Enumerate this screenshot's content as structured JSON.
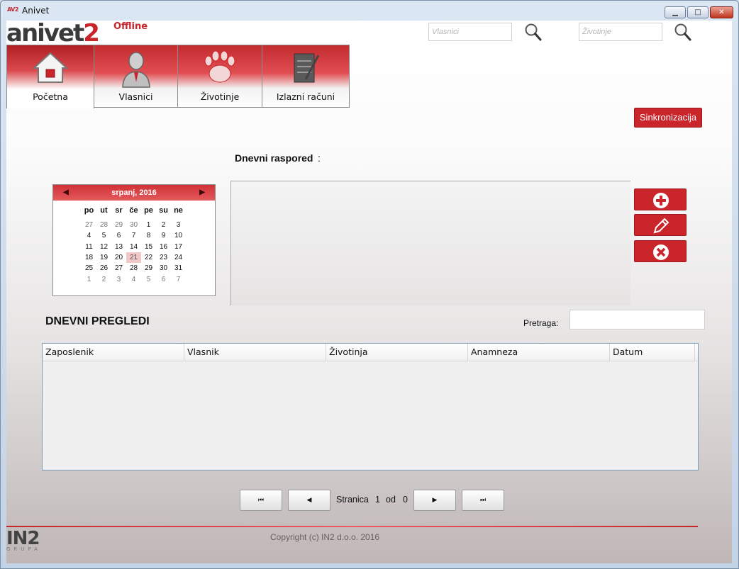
{
  "window": {
    "title": "Anivet",
    "app_icon_text": "AV2",
    "minimize_glyph": "▁",
    "maximize_glyph": "□",
    "close_glyph": "✕"
  },
  "logo": {
    "main": "anivet",
    "two": "2",
    "suffix": "Offline"
  },
  "search": {
    "owners_placeholder": "Vlasnici",
    "animals_placeholder": "Životinje"
  },
  "tabs": [
    {
      "label": "Početna",
      "icon": "home-icon",
      "active": true
    },
    {
      "label": "Vlasnici",
      "icon": "person-icon",
      "active": false
    },
    {
      "label": "Životinje",
      "icon": "paw-icon",
      "active": false
    },
    {
      "label": "Izlazni računi",
      "icon": "invoice-icon",
      "active": false
    }
  ],
  "sync_button": "Sinkronizacija",
  "schedule": {
    "label": "Dnevni raspored",
    "colon": ":"
  },
  "calendar": {
    "month": "srpanj, 2016",
    "prev_glyph": "◀",
    "next_glyph": "▶",
    "weekdays": [
      "po",
      "ut",
      "sr",
      "če",
      "pe",
      "su",
      "ne"
    ],
    "weeks": [
      [
        "27",
        "28",
        "29",
        "30",
        "1",
        "2",
        "3"
      ],
      [
        "4",
        "5",
        "6",
        "7",
        "8",
        "9",
        "10"
      ],
      [
        "11",
        "12",
        "13",
        "14",
        "15",
        "16",
        "17"
      ],
      [
        "18",
        "19",
        "20",
        "21",
        "22",
        "23",
        "24"
      ],
      [
        "25",
        "26",
        "27",
        "28",
        "29",
        "30",
        "31"
      ],
      [
        "1",
        "2",
        "3",
        "4",
        "5",
        "6",
        "7"
      ]
    ],
    "selected": "21"
  },
  "actions": [
    "add-icon",
    "edit-icon",
    "delete-icon"
  ],
  "reviews": {
    "title": "DNEVNI PREGLEDI",
    "search_label": "Pretraga:",
    "columns": [
      "Zaposlenik",
      "Vlasnik",
      "Životinja",
      "Anamneza",
      "Datum"
    ]
  },
  "pager": {
    "first_glyph": "⏮",
    "prev_glyph": "◀",
    "next_glyph": "▶",
    "last_glyph": "⏭",
    "page_label": "Stranica",
    "page": "1",
    "of_label": "od",
    "total": "0"
  },
  "footer": {
    "company_logo": "IN2",
    "company_sub": "GRUPA",
    "copyright": "Copyright (c) IN2 d.o.o. 2016"
  },
  "colors": {
    "accent": "#c9252b",
    "table_border": "#7f9db9"
  }
}
